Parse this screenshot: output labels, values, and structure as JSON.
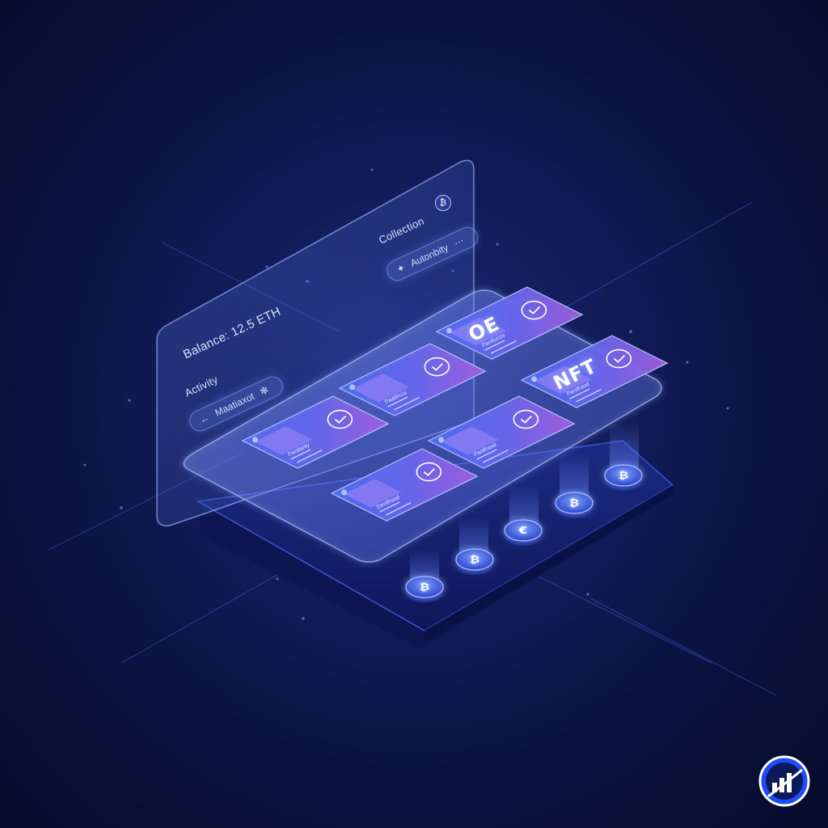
{
  "panel": {
    "balance": "Balance: 12.5 ETH",
    "activity_label": "Activity",
    "collection_label": "Collection",
    "back_pill_label": "Maatiaxot",
    "filter_pill_label": "Autonbity"
  },
  "cards": [
    {
      "title": "Pantlanty",
      "headline": ""
    },
    {
      "title": "Paatlinza",
      "headline": ""
    },
    {
      "title": "Pantlurize",
      "headline": "OE"
    },
    {
      "title": "Dentfrasd",
      "headline": ""
    },
    {
      "title": "Pantfrasd",
      "headline": ""
    },
    {
      "title": "Pantfrasd",
      "headline": "NFT"
    }
  ],
  "coins": [
    "₿",
    "₿",
    "€",
    "₿",
    "₿"
  ],
  "logo": {
    "name": "chart-logo-icon"
  },
  "colors": {
    "background": "#0b1240",
    "accent": "#6f8bff",
    "card_gradient_start": "#4a6cf0",
    "card_gradient_end": "#9a5de0"
  }
}
